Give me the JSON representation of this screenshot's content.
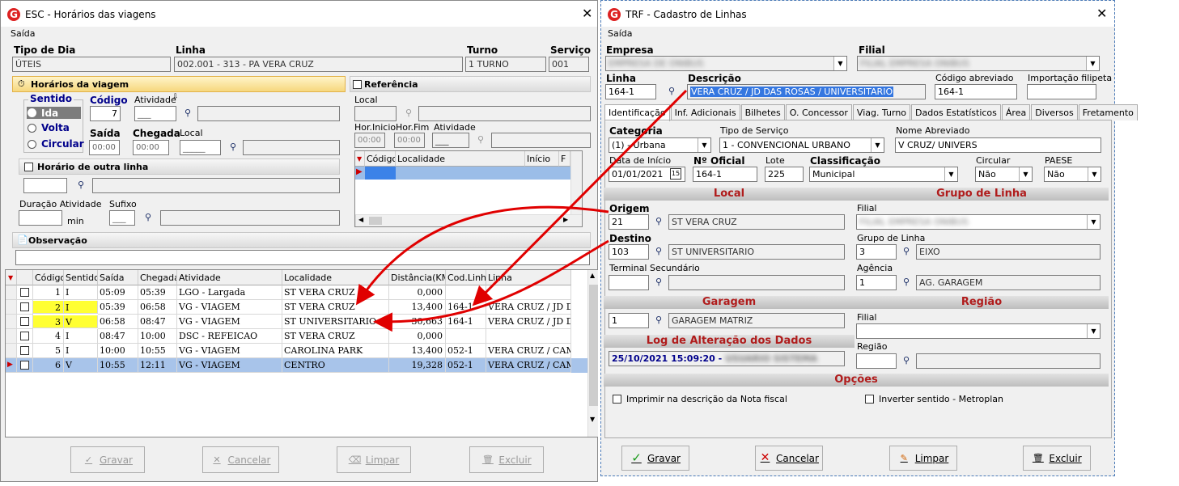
{
  "left": {
    "title": "ESC - Horários das viagens",
    "menu": "Saída",
    "labels": {
      "tipo_dia": "Tipo de Dia",
      "linha": "Linha",
      "turno": "Turno",
      "servico": "Serviço"
    },
    "values": {
      "tipo_dia": "ÚTEIS",
      "linha": "002.001 - 313 - PA VERA CRUZ",
      "turno": "1 TURNO",
      "servico": "001"
    },
    "horarios_title": "Horários da viagem",
    "sentido": "Sentido",
    "ida": "Ida",
    "volta": "Volta",
    "circular": "Circular",
    "codigo_label": "Código",
    "codigo_value": "7",
    "atividade_label": "Atividade",
    "saida_label": "Saída",
    "chegada_label": "Chegada",
    "local_label": "Local",
    "time_ph": "00:00",
    "outra_linha": "Horário de outra linha",
    "duracao": "Duração Atividade",
    "min": "min",
    "sufixo": "Sufixo",
    "referencia": "Referência",
    "ref_local": "Local",
    "hor_inicio": "Hor.Inicio",
    "hor_fim": "Hor.Fim",
    "ref_atividade": "Atividade",
    "ref_grid_headers": [
      "Código",
      "Localidade",
      "Início",
      "F"
    ],
    "observacao": "Observação",
    "grid_headers": [
      "Código",
      "Sentido",
      "Saída",
      "Chegada",
      "Atividade",
      "Localidade",
      "Distância(KM)",
      "Cod.Linha",
      "Linha"
    ],
    "rows": [
      {
        "codigo": "1",
        "sentido": "I",
        "saida": "05:09",
        "chegada": "05:39",
        "atividade": "LGO - Largada",
        "localidade": "ST VERA CRUZ",
        "distancia": "0,000",
        "cod_linha": "",
        "linha": ""
      },
      {
        "codigo": "2",
        "sentido": "I",
        "saida": "05:39",
        "chegada": "06:58",
        "atividade": "VG - VIAGEM",
        "localidade": "ST VERA CRUZ",
        "distancia": "13,400",
        "cod_linha": "164-1",
        "linha": "VERA CRUZ / JD D..."
      },
      {
        "codigo": "3",
        "sentido": "V",
        "saida": "06:58",
        "chegada": "08:47",
        "atividade": "VG - VIAGEM",
        "localidade": "ST UNIVERSITARIO",
        "distancia": "30,663",
        "cod_linha": "164-1",
        "linha": "VERA CRUZ / JD D..."
      },
      {
        "codigo": "4",
        "sentido": "I",
        "saida": "08:47",
        "chegada": "10:00",
        "atividade": "DSC - REFEICAO",
        "localidade": "ST VERA CRUZ",
        "distancia": "0,000",
        "cod_linha": "",
        "linha": ""
      },
      {
        "codigo": "5",
        "sentido": "I",
        "saida": "10:00",
        "chegada": "10:55",
        "atividade": "VG - VIAGEM",
        "localidade": "CAROLINA PARK",
        "distancia": "13,400",
        "cod_linha": "052-1",
        "linha": "VERA CRUZ / CAM..."
      },
      {
        "codigo": "6",
        "sentido": "V",
        "saida": "10:55",
        "chegada": "12:11",
        "atividade": "VG - VIAGEM",
        "localidade": "CENTRO",
        "distancia": "19,328",
        "cod_linha": "052-1",
        "linha": "VERA CRUZ / CAM..."
      }
    ],
    "buttons": {
      "gravar": "Gravar",
      "cancelar": "Cancelar",
      "limpar": "Limpar",
      "excluir": "Excluir"
    }
  },
  "right": {
    "title": "TRF - Cadastro de Linhas",
    "menu": "Saída",
    "empresa": "Empresa",
    "empresa_value": "EMPRESA DE ONIBUS",
    "filial": "Filial",
    "filial_value": "FILIAL EMPRESA ONIBUS",
    "linha": "Linha",
    "linha_value": "164-1",
    "descricao": "Descrição",
    "descricao_value": "VERA CRUZ / JD DAS ROSAS / UNIVERSITARIO",
    "cod_abrev": "Código abreviado",
    "cod_abrev_value": "164-1",
    "importacao": "Importação filipeta",
    "tabs": [
      "Identificação",
      "Inf. Adicionais",
      "Bilhetes",
      "O. Concessor",
      "Viag. Turno",
      "Dados Estatísticos",
      "Área",
      "Diversos",
      "Fretamento"
    ],
    "categoria": "Categoria",
    "categoria_value": "(1) - Urbana",
    "tipo_servico": "Tipo de Serviço",
    "tipo_servico_value": "1 - CONVENCIONAL URBANO",
    "nome_abrev": "Nome Abreviado",
    "nome_abrev_value": "V CRUZ/ UNIVERS",
    "data_inicio": "Data de Início",
    "data_inicio_value": "01/01/2021",
    "n_oficial": "Nº Oficial",
    "n_oficial_value": "164-1",
    "lote": "Lote",
    "lote_value": "225",
    "classificacao": "Classificação",
    "classificacao_value": "Municipal",
    "circular": "Circular",
    "circular_value": "Não",
    "paese": "PAESE",
    "paese_value": "Não",
    "local_header": "Local",
    "grupo_header": "Grupo de Linha",
    "origem": "Origem",
    "origem_code": "21",
    "origem_value": "ST VERA CRUZ",
    "filial2": "Filial",
    "filial2_value": "FILIAL EMPRESA ONIBUS",
    "destino": "Destino",
    "destino_code": "103",
    "destino_value": "ST UNIVERSITARIO",
    "grupo_linha": "Grupo de Linha",
    "grupo_code": "3",
    "grupo_value": "EIXO",
    "terminal": "Terminal Secundário",
    "agencia": "Agência",
    "agencia_code": "1",
    "agencia_value": "AG. GARAGEM",
    "garagem_header": "Garagem",
    "regiao_header": "Região",
    "garagem_code": "1",
    "garagem_value": "GARAGEM MATRIZ",
    "filial3": "Filial",
    "log_header": "Log de Alteração dos Dados",
    "log_value": "25/10/2021 15:09:20 -",
    "log_user": "USUARIO SISTEMA",
    "regiao": "Região",
    "opcoes": "Opções",
    "imprimir": "Imprimir na descrição da Nota fiscal",
    "inverter": "Inverter sentido - Metroplan",
    "buttons": {
      "gravar": "Gravar",
      "cancelar": "Cancelar",
      "limpar": "Limpar",
      "excluir": "Excluir"
    }
  }
}
